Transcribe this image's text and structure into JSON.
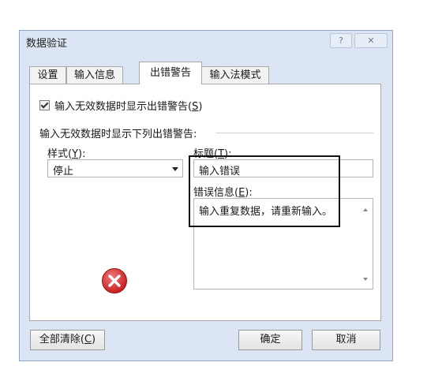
{
  "window": {
    "title": "数据验证",
    "help": "?",
    "close": "✕"
  },
  "tabs": [
    {
      "label": "设置",
      "active": false
    },
    {
      "label": "输入信息",
      "active": false
    },
    {
      "label": "出错警告",
      "active": true
    },
    {
      "label": "输入法模式",
      "active": false
    }
  ],
  "panel": {
    "show_alert": {
      "checked": true,
      "label_prefix": "输入无效数据时显示出错警告(",
      "accel": "S",
      "label_suffix": ")"
    },
    "section_label": "输入无效数据时显示下列出错警告:",
    "style": {
      "label_prefix": "样式(",
      "accel": "Y",
      "label_suffix": "):",
      "value": "停止",
      "icon": "stop-icon"
    },
    "title_field": {
      "label_prefix": "标题(",
      "accel": "T",
      "label_suffix": "):",
      "value": "输入错误"
    },
    "message_field": {
      "label_prefix": "错误信息(",
      "accel": "E",
      "label_suffix": "):",
      "value": "输入重复数据，请重新输入。"
    }
  },
  "buttons": {
    "clear_all": {
      "label_prefix": "全部清除(",
      "accel": "C",
      "label_suffix": ")"
    },
    "ok": "确定",
    "cancel": "取消"
  }
}
